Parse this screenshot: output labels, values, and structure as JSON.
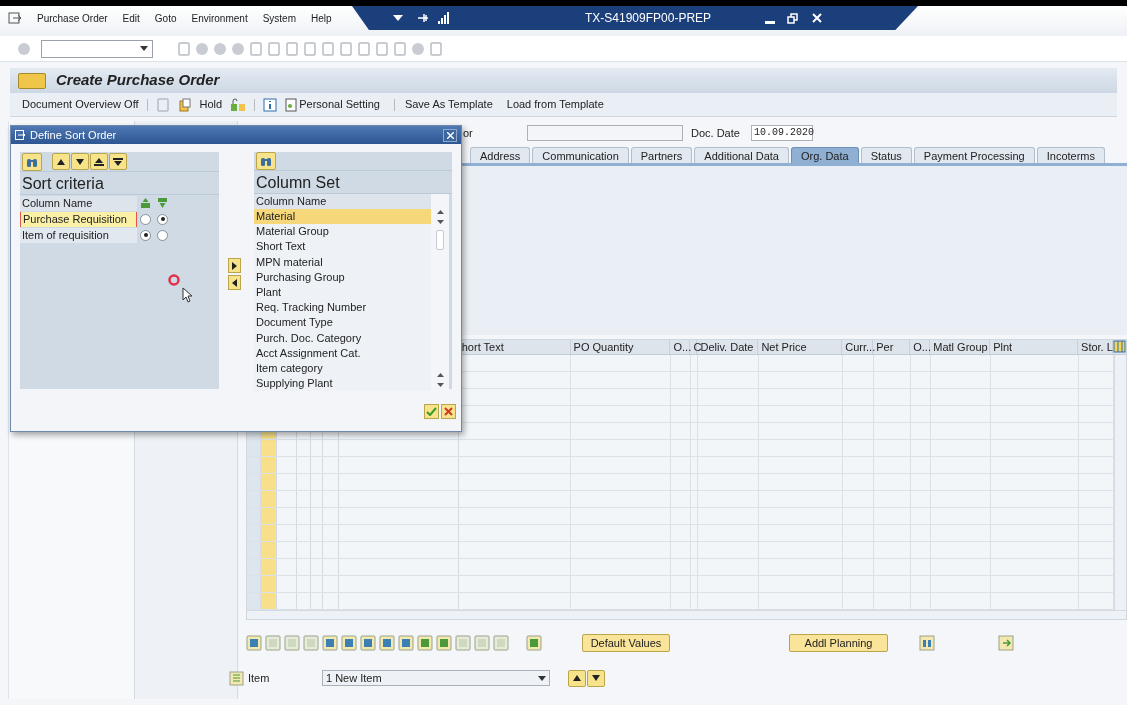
{
  "menu_bar": [
    "Purchase Order",
    "Edit",
    "Goto",
    "Environment",
    "System",
    "Help"
  ],
  "system_title": "TX-S41909FP00-PREP",
  "screen_title": "Create Purchase Order",
  "app_toolbar": [
    "Document Overview Off",
    "Hold",
    "Personal Setting",
    "Save As Template",
    "Load from Template"
  ],
  "header": {
    "vendor_label": "or",
    "doc_date_label": "Doc. Date",
    "doc_date": "10.09.2020"
  },
  "tabs": [
    {
      "label": "Address",
      "selected": false
    },
    {
      "label": "Communication",
      "selected": false
    },
    {
      "label": "Partners",
      "selected": false
    },
    {
      "label": "Additional Data",
      "selected": false
    },
    {
      "label": "Org. Data",
      "selected": true
    },
    {
      "label": "Status",
      "selected": false
    },
    {
      "label": "Payment Processing",
      "selected": false
    },
    {
      "label": "Incoterms",
      "selected": false
    }
  ],
  "item_table": {
    "columns": [
      "hort Text",
      "PO Quantity",
      "O...",
      "C",
      "Deliv. Date",
      "Net Price",
      "Curr...",
      "Per",
      "O...",
      "Matl Group",
      "Plnt",
      "Stor. L"
    ]
  },
  "bottom_buttons": [
    "Default Values",
    "Addl Planning"
  ],
  "item_selector": {
    "label": "Item",
    "value": "1 New Item"
  },
  "dialog": {
    "title": "Define Sort Order",
    "sort_criteria": {
      "heading": "Sort criteria",
      "column_header": "Column Name",
      "rows": [
        {
          "name": "Purchase Requisition",
          "selected": true,
          "ascending": false,
          "descending": true
        },
        {
          "name": "Item of requisition",
          "selected": false,
          "ascending": true,
          "descending": false
        }
      ]
    },
    "column_set": {
      "heading": "Column Set",
      "column_header": "Column Name",
      "items": [
        {
          "label": "Material",
          "selected": true
        },
        {
          "label": "Material Group",
          "selected": false
        },
        {
          "label": "Short Text",
          "selected": false
        },
        {
          "label": "MPN material",
          "selected": false
        },
        {
          "label": "Purchasing Group",
          "selected": false
        },
        {
          "label": "Plant",
          "selected": false
        },
        {
          "label": "Req. Tracking Number",
          "selected": false
        },
        {
          "label": "Document Type",
          "selected": false
        },
        {
          "label": "Purch. Doc. Category",
          "selected": false
        },
        {
          "label": "Acct Assignment Cat.",
          "selected": false
        },
        {
          "label": "Item category",
          "selected": false
        },
        {
          "label": "Supplying Plant",
          "selected": false
        }
      ]
    }
  }
}
